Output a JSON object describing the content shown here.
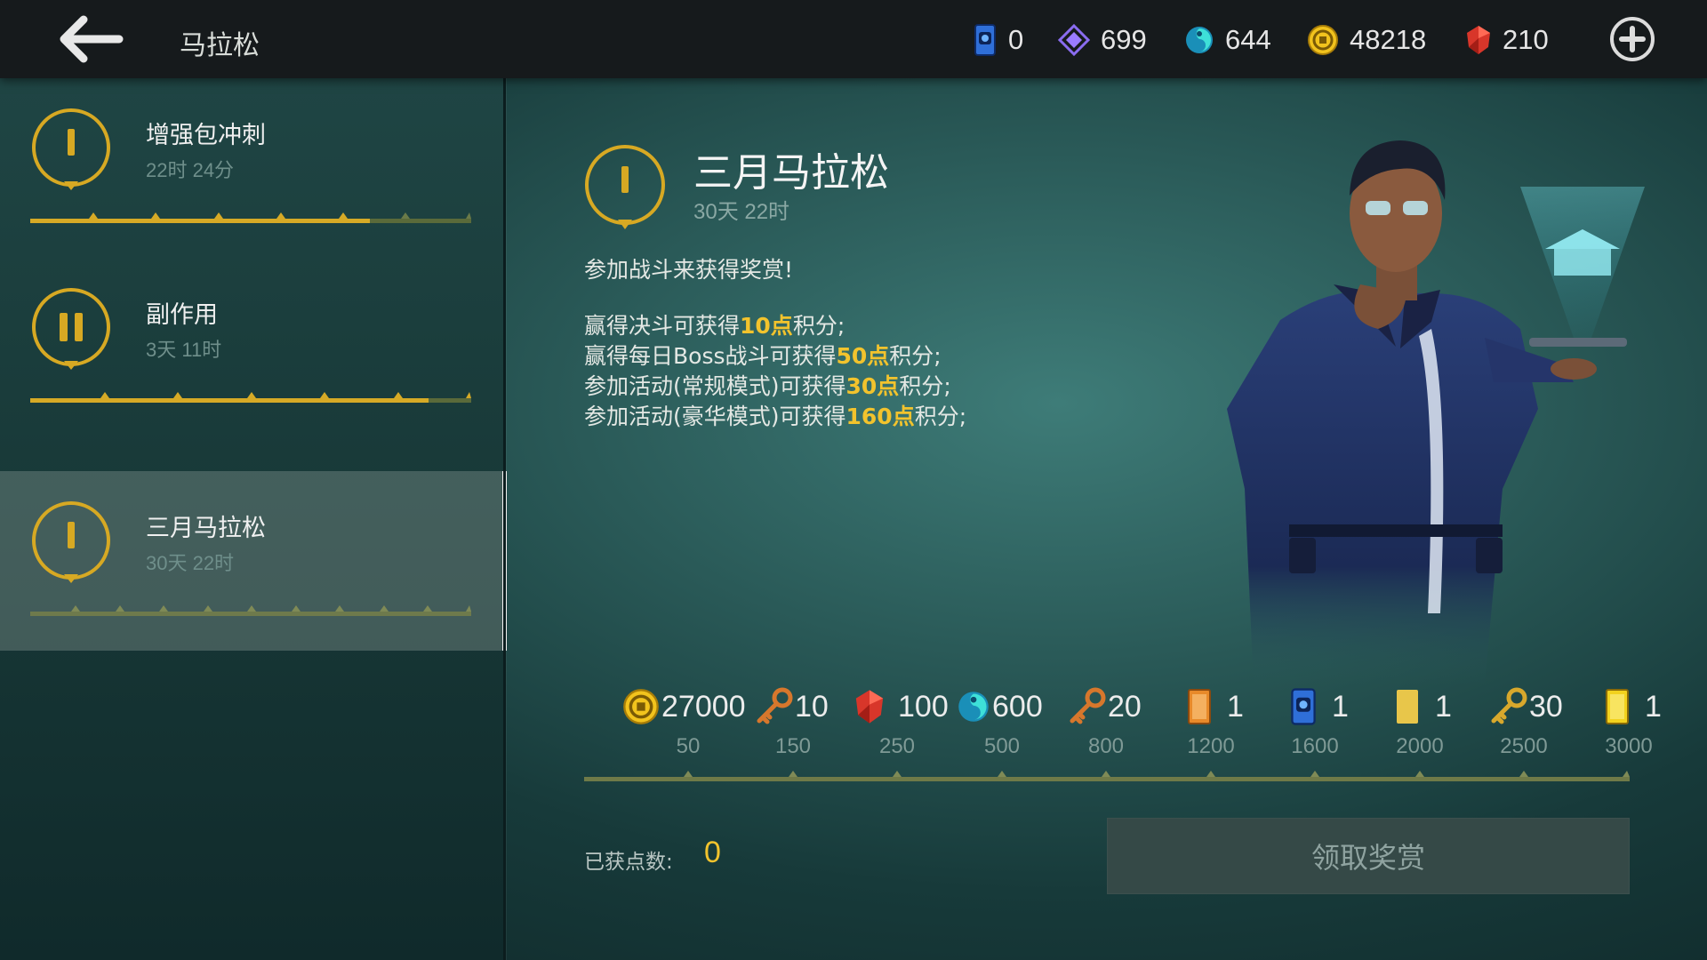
{
  "header": {
    "title": "马拉松",
    "resources": [
      {
        "icon": "blue-card-icon",
        "value": "0"
      },
      {
        "icon": "purple-crystal-icon",
        "value": "699"
      },
      {
        "icon": "teal-orb-icon",
        "value": "644"
      },
      {
        "icon": "gold-coin-icon",
        "value": "48218"
      },
      {
        "icon": "red-gem-icon",
        "value": "210"
      }
    ]
  },
  "sidebar": {
    "items": [
      {
        "name": "增强包冲刺",
        "time": "22时 24分",
        "status": "active",
        "progress": 0.77
      },
      {
        "name": "副作用",
        "time": "3天 11时",
        "status": "paused",
        "progress": 0.9
      },
      {
        "name": "三月马拉松",
        "time": "30天 22时",
        "status": "active",
        "progress": 0.0
      }
    ]
  },
  "main": {
    "title": "三月马拉松",
    "time": "30天 22时",
    "intro": "参加战斗来获得奖赏!",
    "rules": [
      {
        "pre": "赢得决斗可获得",
        "value": "10点",
        "post": "积分;"
      },
      {
        "pre": "赢得每日Boss战斗可获得",
        "value": "50点",
        "post": "积分;"
      },
      {
        "pre": "参加活动(常规模式)可获得",
        "value": "30点",
        "post": "积分;"
      },
      {
        "pre": "参加活动(豪华模式)可获得",
        "value": "160点",
        "post": "积分;"
      }
    ],
    "rewards": [
      {
        "icon": "gold-coin-icon",
        "amount": "27000",
        "points": "50"
      },
      {
        "icon": "key-icon",
        "amount": "10",
        "points": "150"
      },
      {
        "icon": "red-gem-icon",
        "amount": "100",
        "points": "250"
      },
      {
        "icon": "teal-orb-icon",
        "amount": "600",
        "points": "500"
      },
      {
        "icon": "key-icon",
        "amount": "20",
        "points": "800"
      },
      {
        "icon": "orange-card-icon",
        "amount": "1",
        "points": "1200"
      },
      {
        "icon": "blue-card-icon",
        "amount": "1",
        "points": "1600"
      },
      {
        "icon": "yellow-card-icon",
        "amount": "1",
        "points": "2000"
      },
      {
        "icon": "key-icon",
        "amount": "30",
        "points": "2500"
      },
      {
        "icon": "gold-card-icon",
        "amount": "1",
        "points": "3000"
      }
    ],
    "points_label": "已获点数:",
    "points_value": "0",
    "claim_label": "领取奖赏"
  },
  "colors": {
    "accent_gold": "#f2c32d",
    "track_gold": "#d6aa26",
    "bg_teal": "#2a5a58",
    "topbar": "#161a1c"
  }
}
